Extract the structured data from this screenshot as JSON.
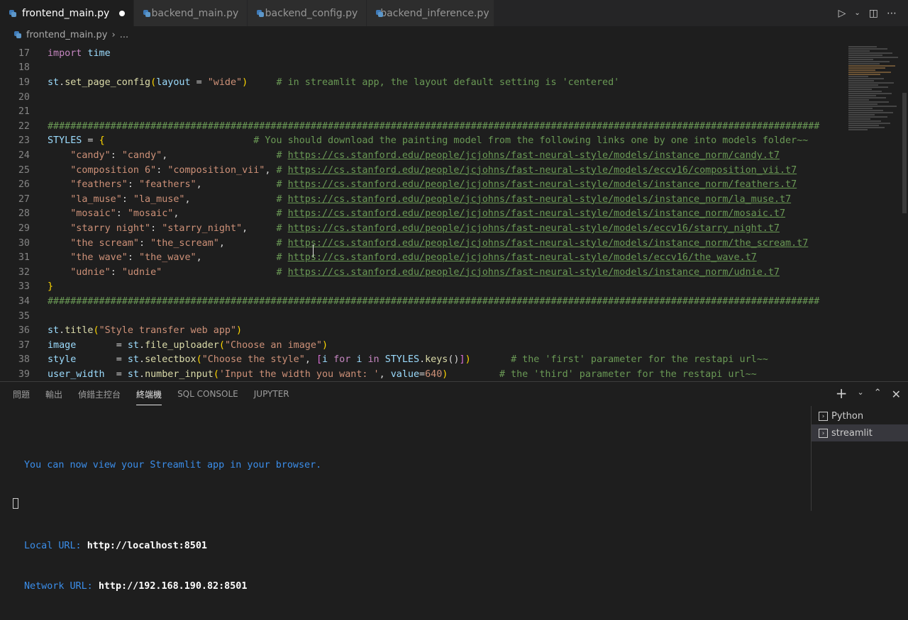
{
  "tabs": [
    {
      "label": "frontend_main.py",
      "active": true,
      "modified": true
    },
    {
      "label": "backend_main.py",
      "active": false
    },
    {
      "label": "backend_config.py",
      "active": false
    },
    {
      "label": "backend_inference.py",
      "active": false
    }
  ],
  "breadcrumb": {
    "file": "frontend_main.py",
    "sep": "›",
    "more": "..."
  },
  "editor": {
    "lines": [
      {
        "n": "17",
        "html": "<span class=\"kw\">import</span> <span class=\"id\">time</span>"
      },
      {
        "n": "18",
        "html": ""
      },
      {
        "n": "19",
        "html": "<span class=\"id\">st</span>.<span class=\"fn\">set_page_config</span><span class=\"br\">(</span><span class=\"id\">layout</span> = <span class=\"st\">\"wide\"</span><span class=\"br\">)</span>     <span class=\"cm\"># in streamlit app, the layout default setting is 'centered'</span>"
      },
      {
        "n": "20",
        "html": ""
      },
      {
        "n": "21",
        "html": ""
      },
      {
        "n": "22",
        "html": "<span class=\"cm\">#######################################################################################################################################</span>"
      },
      {
        "n": "23",
        "html": "<span class=\"id\">STYLES</span> = <span class=\"br\">{</span>                          <span class=\"cm\"># You should download the painting model from the following links one by one into models folder~~</span>"
      },
      {
        "n": "24",
        "html": "    <span class=\"st\">\"candy\"</span>: <span class=\"st\">\"candy\"</span>,                   <span class=\"cm\"># </span><span class=\"url\">https://cs.stanford.edu/people/jcjohns/fast-neural-style/models/instance_norm/candy.t7</span>"
      },
      {
        "n": "25",
        "html": "    <span class=\"st\">\"composition 6\"</span>: <span class=\"st\">\"composition_vii\"</span>, <span class=\"cm\"># </span><span class=\"url\">https://cs.stanford.edu/people/jcjohns/fast-neural-style/models/eccv16/composition_vii.t7</span>"
      },
      {
        "n": "26",
        "html": "    <span class=\"st\">\"feathers\"</span>: <span class=\"st\">\"feathers\"</span>,             <span class=\"cm\"># </span><span class=\"url\">https://cs.stanford.edu/people/jcjohns/fast-neural-style/models/instance_norm/feathers.t7</span>"
      },
      {
        "n": "27",
        "html": "    <span class=\"st\">\"la_muse\"</span>: <span class=\"st\">\"la_muse\"</span>,               <span class=\"cm\"># </span><span class=\"url\">https://cs.stanford.edu/people/jcjohns/fast-neural-style/models/instance_norm/la_muse.t7</span>"
      },
      {
        "n": "28",
        "html": "    <span class=\"st\">\"mosaic\"</span>: <span class=\"st\">\"mosaic\"</span>,                 <span class=\"cm\"># </span><span class=\"url\">https://cs.stanford.edu/people/jcjohns/fast-neural-style/models/instance_norm/mosaic.t7</span>"
      },
      {
        "n": "29",
        "html": "    <span class=\"st\">\"starry night\"</span>: <span class=\"st\">\"starry_night\"</span>,     <span class=\"cm\"># </span><span class=\"url\">https://cs.stanford.edu/people/jcjohns/fast-neural-style/models/eccv16/starry_night.t7</span>"
      },
      {
        "n": "30",
        "html": "    <span class=\"st\">\"the scream\"</span>: <span class=\"st\">\"the_scream\"</span>,         <span class=\"cm\"># </span><span class=\"url\">https://cs.stanford.edu/people/jcjohns/fast-neural-style/models/instance_norm/the_scream.t7</span>"
      },
      {
        "n": "31",
        "html": "    <span class=\"st\">\"the wave\"</span>: <span class=\"st\">\"the_wave\"</span>,             <span class=\"cm\"># </span><span class=\"url\">https://cs.stanford.edu/people/jcjohns/fast-neural-style/models/eccv16/the_wave.t7</span>"
      },
      {
        "n": "32",
        "html": "    <span class=\"st\">\"udnie\"</span>: <span class=\"st\">\"udnie\"</span>                    <span class=\"cm\"># </span><span class=\"url\">https://cs.stanford.edu/people/jcjohns/fast-neural-style/models/instance_norm/udnie.t7</span>"
      },
      {
        "n": "33",
        "html": "<span class=\"br\">}</span>"
      },
      {
        "n": "34",
        "html": "<span class=\"cm\">#######################################################################################################################################</span>"
      },
      {
        "n": "35",
        "html": ""
      },
      {
        "n": "36",
        "html": "<span class=\"id\">st</span>.<span class=\"fn\">title</span><span class=\"br\">(</span><span class=\"st\">\"Style transfer web app\"</span><span class=\"br\">)</span>"
      },
      {
        "n": "37",
        "html": "<span class=\"id\">image</span>       = <span class=\"id\">st</span>.<span class=\"fn\">file_uploader</span><span class=\"br\">(</span><span class=\"st\">\"Choose an image\"</span><span class=\"br\">)</span>"
      },
      {
        "n": "38",
        "html": "<span class=\"id\">style</span>       = <span class=\"id\">st</span>.<span class=\"fn\">selectbox</span><span class=\"br\">(</span><span class=\"st\">\"Choose the style\"</span>, <span class=\"br2\">[</span><span class=\"id\">i</span> <span class=\"kw\">for</span> <span class=\"id\">i</span> <span class=\"kw\">in</span> <span class=\"id\">STYLES</span>.<span class=\"fn\">keys</span>()<span class=\"br2\">]</span><span class=\"br\">)</span>       <span class=\"cm\"># the 'first' parameter for the restapi url~~</span>"
      },
      {
        "n": "39",
        "html": "<span class=\"id\">user_width</span>  = <span class=\"id\">st</span>.<span class=\"fn\">number_input</span><span class=\"br\">(</span><span class=\"st\">'Input the width you want: '</span>, <span class=\"id\">value</span>=<span class=\"st\">640</span><span class=\"br\">)</span>         <span class=\"cm\"># the 'third' parameter for the restapi url~~</span>"
      }
    ]
  },
  "panel": {
    "tabs": [
      "問題",
      "輸出",
      "偵錯主控台",
      "終端機",
      "SQL CONSOLE",
      "JUPYTER"
    ],
    "active_tab": "終端機",
    "add_label": "+",
    "terminal": {
      "line1": "You can now view your Streamlit app in your browser.",
      "local_label": "Local URL: ",
      "local_url": "http://localhost:8501",
      "network_label": "Network URL: ",
      "network_url": "http://192.168.190.82:8501"
    },
    "terminals": [
      "Python",
      "streamlit"
    ],
    "active_terminal": "streamlit"
  }
}
